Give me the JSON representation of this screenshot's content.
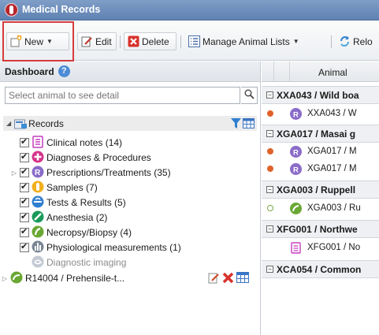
{
  "window": {
    "title": "Medical Records"
  },
  "toolbar": {
    "new_label": "New",
    "edit_label": "Edit",
    "delete_label": "Delete",
    "manage_lists_label": "Manage Animal Lists",
    "reload_label": "Relo"
  },
  "dashboard": {
    "title": "Dashboard",
    "search_placeholder": "Select animal to see detail",
    "records_label": "Records",
    "categories": [
      {
        "label": "Clinical notes (14)",
        "icon": "clinical-notes-icon",
        "color": "#c53fc1"
      },
      {
        "label": "Diagnoses & Procedures",
        "icon": "diagnoses-icon",
        "color": "#d6338b"
      },
      {
        "label": "Prescriptions/Treatments (35)",
        "icon": "prescription-icon",
        "color": "#8a6cc9"
      },
      {
        "label": "Samples (7)",
        "icon": "samples-icon",
        "color": "#f2b01e"
      },
      {
        "label": "Tests & Results (5)",
        "icon": "tests-icon",
        "color": "#2f7fd0"
      },
      {
        "label": "Anesthesia (2)",
        "icon": "anesthesia-icon",
        "color": "#1a9a5a"
      },
      {
        "label": "Necropsy/Biopsy (4)",
        "icon": "necropsy-icon",
        "color": "#6aa834"
      },
      {
        "label": "Physiological measurements (1)",
        "icon": "physiological-icon",
        "color": "#7a8694"
      },
      {
        "label": "Diagnostic imaging",
        "icon": "imaging-icon",
        "color": "#9aa6b6"
      }
    ],
    "animal_entry": "R14004 / Prehensile-t..."
  },
  "grid": {
    "column_animal": "Animal",
    "groups": [
      {
        "title": "XXA043 / Wild boa",
        "records": [
          {
            "text": "XXA043 / W",
            "status": "orange"
          }
        ]
      },
      {
        "title": "XGA017 / Masai g",
        "records": [
          {
            "text": "XGA017 / M",
            "status": "orange"
          },
          {
            "text": "XGA017 / M",
            "status": "orange"
          }
        ]
      },
      {
        "title": "XGA003 / Ruppell",
        "records": [
          {
            "text": "XGA003 / Ru",
            "status": "empty"
          }
        ]
      },
      {
        "title": "XFG001 / Northwe",
        "records": [
          {
            "text": "XFG001 / No",
            "status": "none"
          }
        ]
      },
      {
        "title": "XCA054 / Common",
        "records": []
      }
    ]
  },
  "colors": {
    "titlebar": "#6b8bbd",
    "highlight": "#d63c3c",
    "status_orange": "#e0622b"
  }
}
